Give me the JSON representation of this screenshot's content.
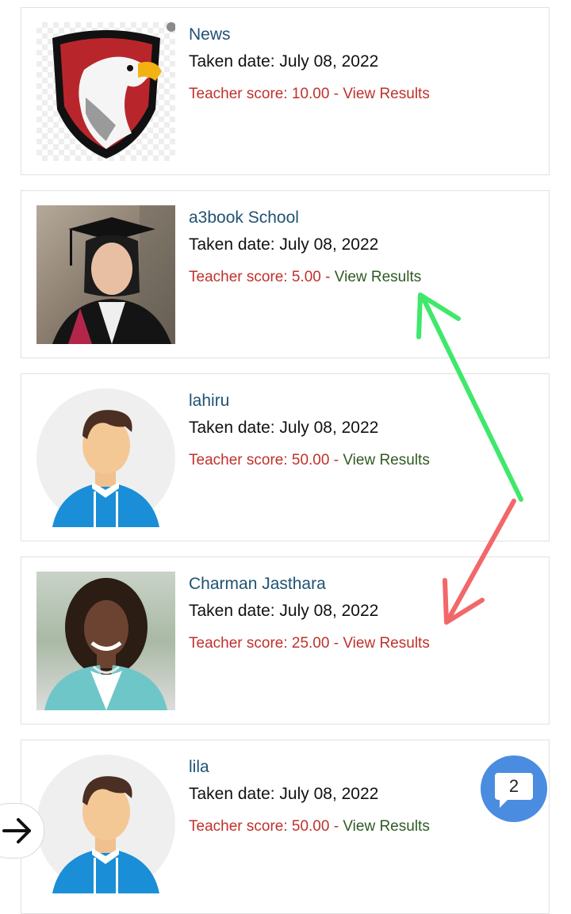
{
  "results": [
    {
      "name": "News",
      "date": "Taken date: July 08, 2022",
      "score": "Teacher score: 10.00",
      "sep": " - ",
      "view": "View Results",
      "avatar": "eagle-shield-logo"
    },
    {
      "name": "a3book School",
      "date": "Taken date: July 08, 2022",
      "score": "Teacher score: 5.00",
      "sep": " - ",
      "view": "View Results",
      "avatar": "graduate-photo"
    },
    {
      "name": "lahiru",
      "date": "Taken date: July 08, 2022",
      "score": "Teacher score: 50.00",
      "sep": " - ",
      "view": "View Results",
      "avatar": "male-avatar"
    },
    {
      "name": "Charman Jasthara",
      "date": "Taken date: July 08, 2022",
      "score": "Teacher score: 25.00",
      "sep": " - ",
      "view": "View Results",
      "avatar": "woman-photo"
    },
    {
      "name": "lila",
      "date": "Taken date: July 08, 2022",
      "score": "Teacher score: 50.00",
      "sep": " - ",
      "view": "View Results",
      "avatar": "male-avatar"
    }
  ],
  "chat": {
    "badge": "2",
    "icon": "chat-bubble-icon"
  },
  "nav": {
    "icon": "arrow-right-icon"
  },
  "annotations": {
    "green_arrow_color": "#3fe86a",
    "red_arrow_color": "#f2676a"
  },
  "colors": {
    "name": "#1f5273",
    "score": "#c0312b",
    "view_link": "#2f5a22",
    "chat_fab": "#4a8de0"
  }
}
